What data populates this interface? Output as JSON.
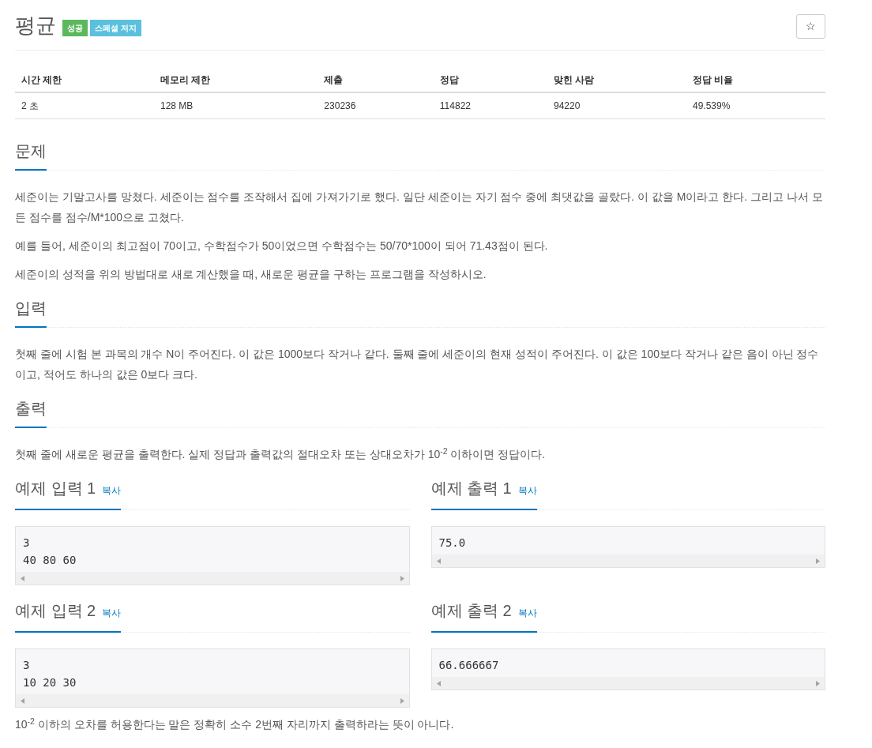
{
  "title": "평균",
  "badges": [
    {
      "label": "성공",
      "color": "#5cb85c"
    },
    {
      "label": "스페셜 저지",
      "color": "#5bc0de"
    }
  ],
  "star_button": {
    "label": "☆"
  },
  "info_table": {
    "columns": [
      "시간 제한",
      "메모리 제한",
      "제출",
      "정답",
      "맞힌 사람",
      "정답 비율"
    ],
    "rows": [
      [
        "2 초",
        "128 MB",
        "230236",
        "114822",
        "94220",
        "49.539%"
      ]
    ]
  },
  "sections": [
    {
      "heading": "문제",
      "paragraphs": [
        "세준이는 기말고사를 망쳤다. 세준이는 점수를 조작해서 집에 가져가기로 했다. 일단 세준이는 자기 점수 중에 최댓값을 골랐다. 이 값을 M이라고 한다. 그리고 나서 모든 점수를 점수/M*100으로 고쳤다.",
        "예를 들어, 세준이의 최고점이 70이고, 수학점수가 50이었으면 수학점수는 50/70*100이 되어 71.43점이 된다.",
        "세준이의 성적을 위의 방법대로 새로 계산했을 때, 새로운 평균을 구하는 프로그램을 작성하시오."
      ]
    },
    {
      "heading": "입력",
      "paragraphs": [
        "첫째 줄에 시험 본 과목의 개수 N이 주어진다. 이 값은 1000보다 작거나 같다. 둘째 줄에 세준이의 현재 성적이 주어진다. 이 값은 100보다 작거나 같은 음이 아닌 정수이고, 적어도 하나의 값은 0보다 크다."
      ]
    },
    {
      "heading": "출력",
      "paragraphs": [
        "첫째 줄에 새로운 평균을 출력한다. 실제 정답과 출력값의 절대오차 또는 상대오차가 10$^{-2}$ 이하이면 정답이다."
      ]
    }
  ],
  "samples": [
    {
      "title": "예제 입력 1",
      "copy": "복사",
      "lines": [
        "3",
        "40 80 60"
      ]
    },
    {
      "title": "예제 출력 1",
      "copy": "복사",
      "lines": [
        "75.0"
      ]
    },
    {
      "title": "예제 입력 2",
      "copy": "복사",
      "lines": [
        "3",
        "10 20 30"
      ]
    },
    {
      "title": "예제 출력 2",
      "copy": "복사",
      "lines": [
        "66.666667"
      ]
    }
  ],
  "note": "10$^{-2}$ 이하의 오차를 허용한다는 말은 정확히 소수 2번째 자리까지 출력하라는 뜻이 아니다."
}
